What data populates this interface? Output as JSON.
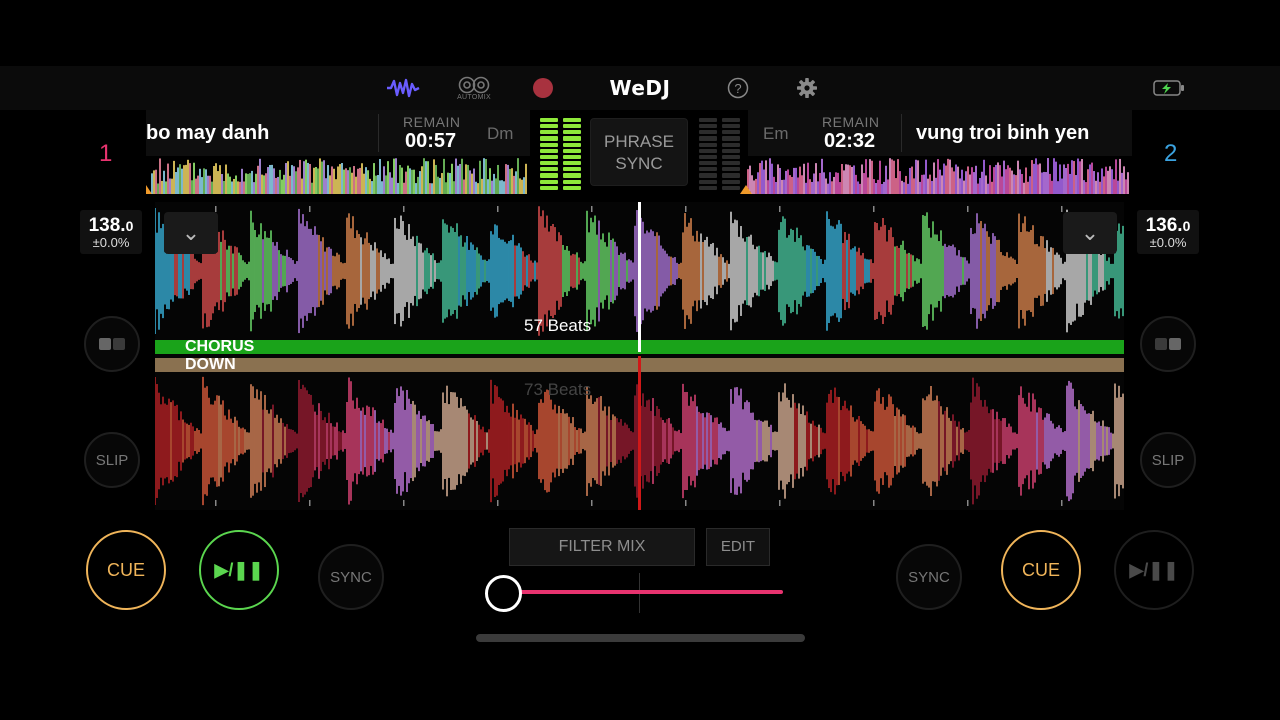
{
  "app": {
    "name": "WeDJ"
  },
  "toolbar": {
    "automix_label": "AUTOMIX",
    "icons": [
      "waveform-icon",
      "automix-icon",
      "record-icon",
      "help-icon",
      "settings-icon",
      "battery-charging-icon"
    ]
  },
  "decks": {
    "left": {
      "number": "1",
      "title": "bo may danh",
      "remain_label": "REMAIN",
      "remain_time": "00:57",
      "key": "Dm",
      "bpm": "138.",
      "bpm_decimal": "0",
      "pitch": "±0.0%",
      "meter_level": 1.0
    },
    "right": {
      "number": "2",
      "title": "vung troi binh yen",
      "remain_label": "REMAIN",
      "remain_time": "02:32",
      "key": "Em",
      "bpm": "136.",
      "bpm_decimal": "0",
      "pitch": "±0.0%",
      "meter_level": 0.0
    }
  },
  "phrase_sync": {
    "line1": "PHRASE",
    "line2": "SYNC"
  },
  "waveform": {
    "top_beats": "57 Beats",
    "bottom_beats": "73 Beats",
    "phrase_top": "CHORUS",
    "phrase_bottom": "DOWN"
  },
  "transport": {
    "left": {
      "slip": "SLIP",
      "cue": "CUE",
      "play": "▶/❚❚",
      "sync": "SYNC"
    },
    "right": {
      "slip": "SLIP",
      "cue": "CUE",
      "play": "▶/❚❚",
      "sync": "SYNC"
    }
  },
  "mixer": {
    "filter_mix": "FILTER MIX",
    "edit": "EDIT",
    "crossfader_position": 0.0
  },
  "colors": {
    "deck1": "#e8336f",
    "deck2": "#3ba3e0",
    "cue": "#f0b55a",
    "play": "#5bd64f",
    "chorus": "#1aa31a",
    "down": "#8a7150",
    "crossfader": "#e8336f"
  }
}
